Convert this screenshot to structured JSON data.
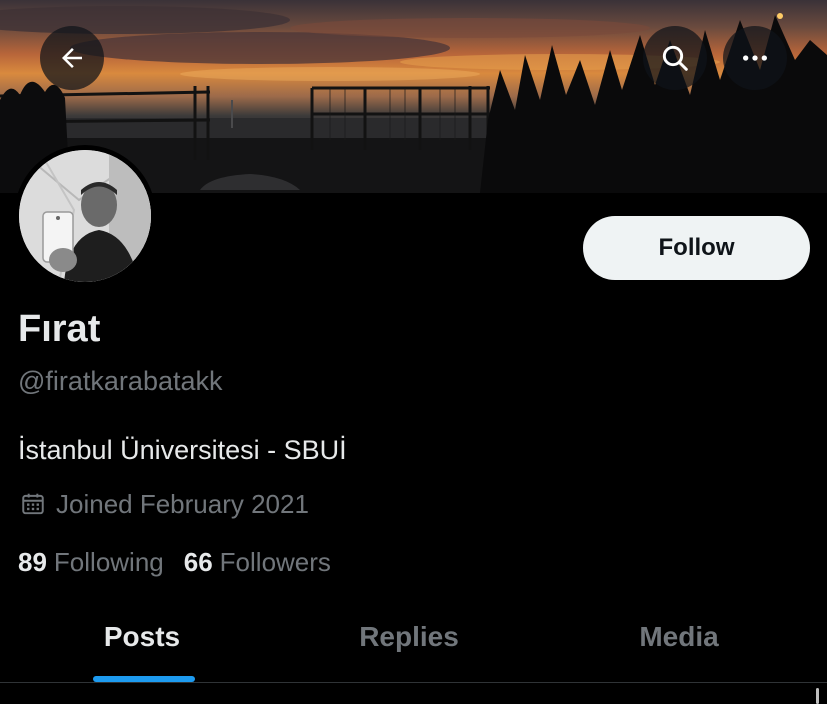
{
  "icons": {
    "back": "arrow-left-icon",
    "search": "search-icon",
    "more": "more-horizontal-icon",
    "calendar": "calendar-icon"
  },
  "colors": {
    "background": "#000000",
    "primary_text": "#e7e9ea",
    "secondary_text": "#71767b",
    "follow_button_bg": "#eff3f4",
    "follow_button_text": "#0f1419",
    "tab_indicator": "#1d9bf0",
    "divider": "#2f3336"
  },
  "profile": {
    "follow_label": "Follow",
    "display_name": "Fırat",
    "handle": "@firatkarabatakk",
    "bio": "İstanbul Üniversitesi - SBUİ",
    "joined": "Joined February 2021",
    "following_count": "89",
    "following_label": "Following",
    "followers_count": "66",
    "followers_label": "Followers"
  },
  "tabs": [
    {
      "label": "Posts",
      "active": true
    },
    {
      "label": "Replies",
      "active": false
    },
    {
      "label": "Media",
      "active": false
    }
  ]
}
